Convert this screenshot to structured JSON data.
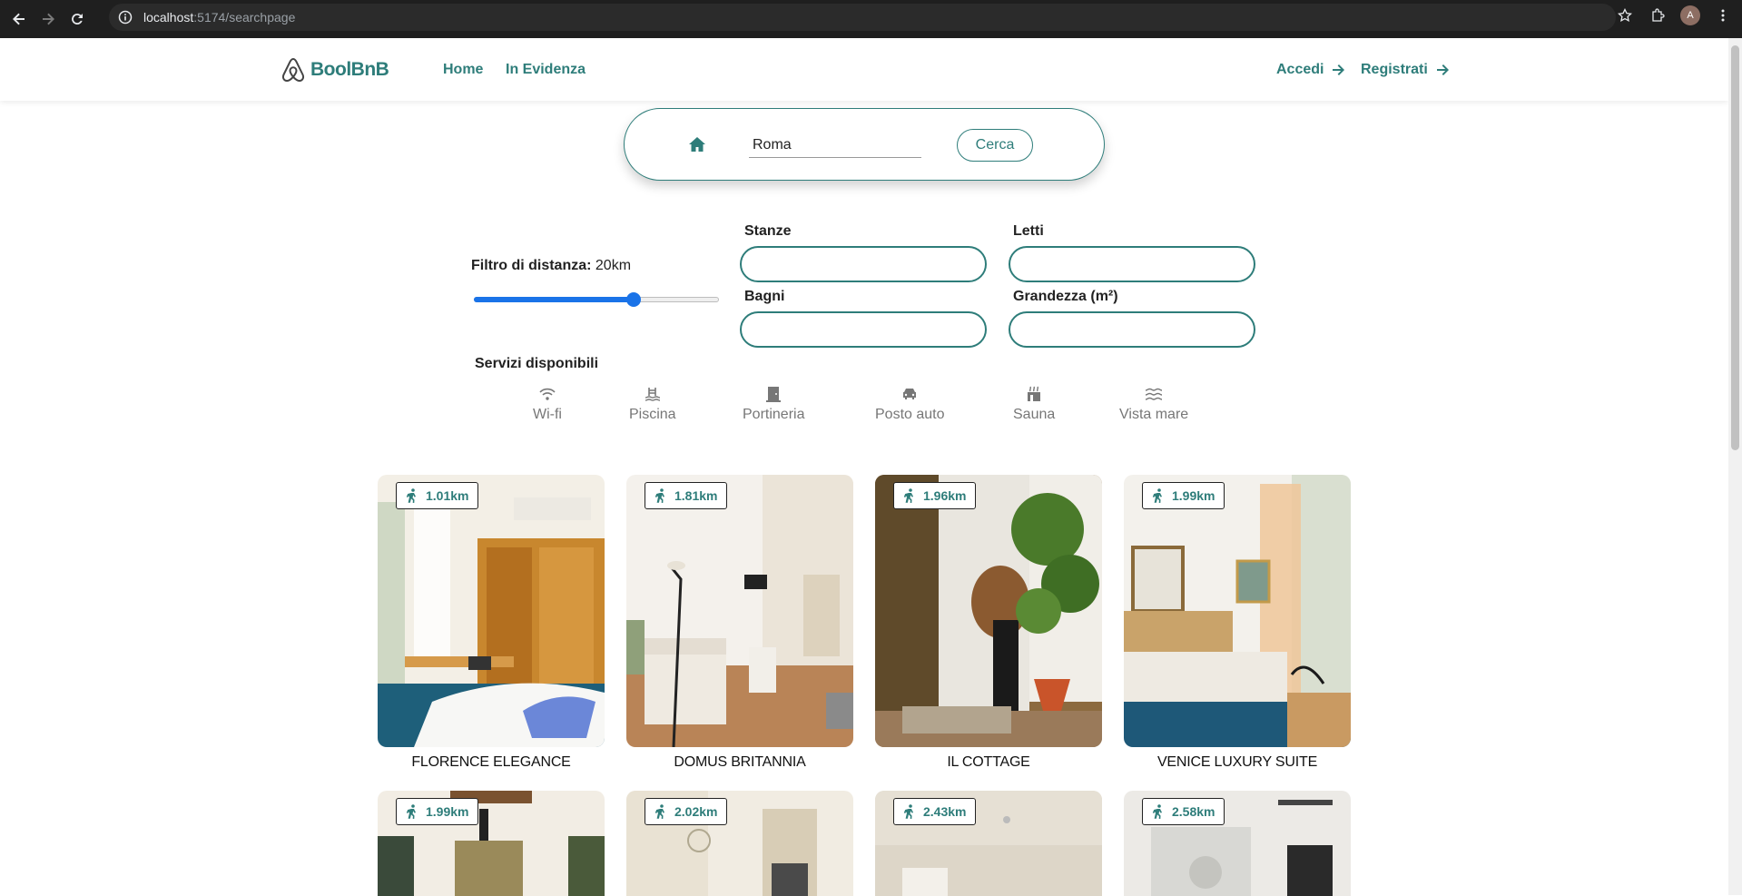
{
  "browser": {
    "url_host": "localhost",
    "url_path": ":5174/searchpage",
    "avatar_letter": "A"
  },
  "header": {
    "logo_text": "BoolBnB",
    "nav": [
      {
        "label": "Home"
      },
      {
        "label": "In Evidenza"
      }
    ],
    "login_label": "Accedi",
    "register_label": "Registrati"
  },
  "search": {
    "value": "Roma",
    "button_label": "Cerca"
  },
  "filters": {
    "distance_label": "Filtro di distanza:",
    "distance_value": "20km",
    "distance_fraction": 0.65,
    "rooms_label": "Stanze",
    "beds_label": "Letti",
    "bathrooms_label": "Bagni",
    "size_label": "Grandezza (m²)"
  },
  "services": {
    "title": "Servizi disponibili",
    "items": [
      {
        "label": "Wi-fi",
        "icon": "wifi-icon"
      },
      {
        "label": "Piscina",
        "icon": "pool-icon"
      },
      {
        "label": "Portineria",
        "icon": "door-icon"
      },
      {
        "label": "Posto auto",
        "icon": "car-icon"
      },
      {
        "label": "Sauna",
        "icon": "sauna-icon"
      },
      {
        "label": "Vista mare",
        "icon": "waves-icon"
      }
    ]
  },
  "listings": [
    {
      "distance": "1.01km",
      "title": "FLORENCE ELEGANCE"
    },
    {
      "distance": "1.81km",
      "title": "DOMUS BRITANNIA"
    },
    {
      "distance": "1.96km",
      "title": "IL COTTAGE"
    },
    {
      "distance": "1.99km",
      "title": "VENICE LUXURY SUITE"
    },
    {
      "distance": "1.99km"
    },
    {
      "distance": "2.02km"
    },
    {
      "distance": "2.43km"
    },
    {
      "distance": "2.58km"
    }
  ],
  "colors": {
    "brand": "#2e7d7a",
    "slider": "#1a73e8"
  }
}
